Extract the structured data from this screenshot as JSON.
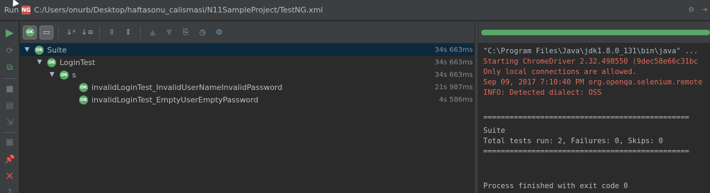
{
  "window": {
    "run_label": "Run",
    "ng_icon_text": "NG",
    "config_path": "C:/Users/onurb/Desktop/haftasonu_calismasi/N11SampleProject/TestNG.xml"
  },
  "colors": {
    "pass_green": "#59a869",
    "error_red": "#e06c5d",
    "selection_blue": "#0d293e"
  },
  "progress": {
    "percent": 100
  },
  "tree": [
    {
      "name": "Suite",
      "time": "34s 663ms",
      "expanded": true,
      "selected": true,
      "icon": "ok-icon"
    },
    {
      "name": "LoginTest",
      "time": "34s 663ms",
      "expanded": true,
      "selected": false,
      "icon": "ok-icon"
    },
    {
      "name": "s",
      "time": "34s 663ms",
      "expanded": true,
      "selected": false,
      "icon": "ok-icon"
    },
    {
      "name": "invalidLoginTest_InvalidUserNameInvalidPassword",
      "time": "21s 987ms",
      "expanded": false,
      "selected": false,
      "icon": "ok-icon"
    },
    {
      "name": "invalidLoginTest_EmptyUserEmptyPassword",
      "time": "4s 586ms",
      "expanded": false,
      "selected": false,
      "icon": "ok-icon"
    }
  ],
  "console": [
    {
      "text": "\"C:\\Program Files\\Java\\jdk1.8.0_131\\bin\\java\" ...",
      "style": "gray"
    },
    {
      "text": "Starting ChromeDriver 2.32.498550 (9dec58e66c31bc",
      "style": "red"
    },
    {
      "text": "Only local connections are allowed.",
      "style": "red"
    },
    {
      "text": "Sep 09, 2017 7:10:40 PM org.openqa.selenium.remote",
      "style": "red"
    },
    {
      "text": "INFO: Detected dialect: OSS",
      "style": "red"
    },
    {
      "text": "",
      "style": "white"
    },
    {
      "text": "===============================================",
      "style": "white"
    },
    {
      "text": "Suite",
      "style": "white"
    },
    {
      "text": "Total tests run: 2, Failures: 0, Skips: 0",
      "style": "white"
    },
    {
      "text": "===============================================",
      "style": "white"
    },
    {
      "text": "",
      "style": "white"
    },
    {
      "text": "",
      "style": "white"
    },
    {
      "text": "",
      "style": "white"
    },
    {
      "text": "Process finished with exit code 0",
      "style": "white"
    }
  ]
}
